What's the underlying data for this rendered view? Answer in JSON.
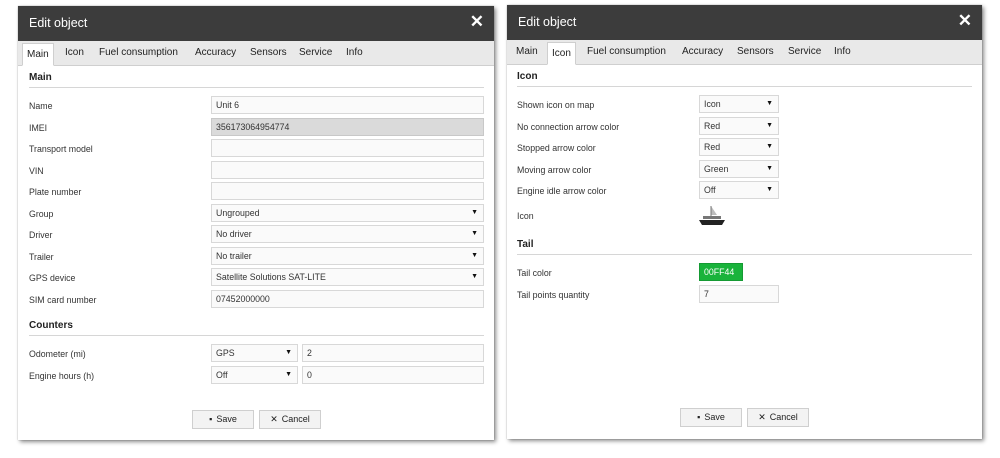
{
  "left": {
    "title": "Edit object",
    "close": "✕",
    "tabs": [
      "Main",
      "Icon",
      "Fuel consumption",
      "Accuracy",
      "Sensors",
      "Service",
      "Info"
    ],
    "section_main": "Main",
    "fields": {
      "name": {
        "label": "Name",
        "value": "Unit 6"
      },
      "imei": {
        "label": "IMEI",
        "value": "356173064954774"
      },
      "transport_model": {
        "label": "Transport model",
        "value": ""
      },
      "vin": {
        "label": "VIN",
        "value": ""
      },
      "plate": {
        "label": "Plate number",
        "value": ""
      },
      "group": {
        "label": "Group",
        "value": "Ungrouped"
      },
      "driver": {
        "label": "Driver",
        "value": "No driver"
      },
      "trailer": {
        "label": "Trailer",
        "value": "No trailer"
      },
      "gps": {
        "label": "GPS device",
        "value": "Satellite Solutions SAT-LITE"
      },
      "sim": {
        "label": "SIM card number",
        "value": "07452000000"
      }
    },
    "section_counters": "Counters",
    "counters": {
      "odometer": {
        "label": "Odometer (mi)",
        "source": "GPS",
        "value": "2"
      },
      "engine_hours": {
        "label": "Engine hours (h)",
        "source": "Off",
        "value": "0"
      }
    },
    "save": "Save",
    "cancel": "Cancel"
  },
  "right": {
    "title": "Edit object",
    "close": "✕",
    "tabs": [
      "Main",
      "Icon",
      "Fuel consumption",
      "Accuracy",
      "Sensors",
      "Service",
      "Info"
    ],
    "section_icon": "Icon",
    "icon_fields": {
      "shown_icon": {
        "label": "Shown icon on map",
        "value": "Icon"
      },
      "no_conn": {
        "label": "No connection arrow color",
        "value": "Red"
      },
      "stopped": {
        "label": "Stopped arrow color",
        "value": "Red"
      },
      "moving": {
        "label": "Moving arrow color",
        "value": "Green"
      },
      "idle": {
        "label": "Engine idle arrow color",
        "value": "Off"
      },
      "icon": {
        "label": "Icon"
      }
    },
    "section_tail": "Tail",
    "tail": {
      "color": {
        "label": "Tail color",
        "value": "00FF44"
      },
      "points": {
        "label": "Tail points quantity",
        "value": "7"
      }
    },
    "save": "Save",
    "cancel": "Cancel"
  },
  "colors": {
    "titlebar": "#3c3c3c",
    "tail_color": "#19b33b"
  },
  "icons": {
    "close": "close-icon",
    "save": "save-icon",
    "cancel": "cancel-icon",
    "dropdown": "chevron-down-icon",
    "boat": "boat-icon"
  }
}
